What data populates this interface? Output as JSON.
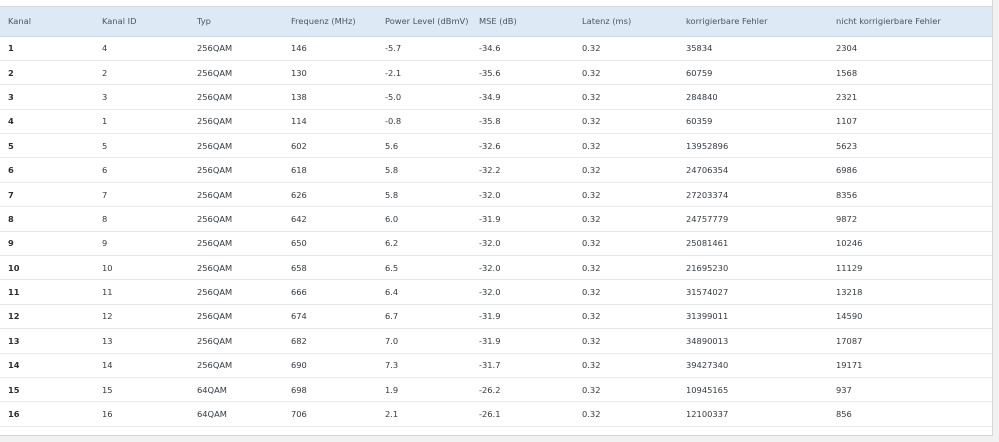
{
  "table": {
    "headers": [
      "Kanal",
      "Kanal ID",
      "Typ",
      "Frequenz (MHz)",
      "Power Level (dBmV)",
      "MSE (dB)",
      "Latenz (ms)",
      "korrigierbare Fehler",
      "nicht korrigierbare Fehler"
    ],
    "rows": [
      [
        "1",
        "4",
        "256QAM",
        "146",
        "-5.7",
        "-34.6",
        "0.32",
        "35834",
        "2304"
      ],
      [
        "2",
        "2",
        "256QAM",
        "130",
        "-2.1",
        "-35.6",
        "0.32",
        "60759",
        "1568"
      ],
      [
        "3",
        "3",
        "256QAM",
        "138",
        "-5.0",
        "-34.9",
        "0.32",
        "284840",
        "2321"
      ],
      [
        "4",
        "1",
        "256QAM",
        "114",
        "-0.8",
        "-35.8",
        "0.32",
        "60359",
        "1107"
      ],
      [
        "5",
        "5",
        "256QAM",
        "602",
        "5.6",
        "-32.6",
        "0.32",
        "13952896",
        "5623"
      ],
      [
        "6",
        "6",
        "256QAM",
        "618",
        "5.8",
        "-32.2",
        "0.32",
        "24706354",
        "6986"
      ],
      [
        "7",
        "7",
        "256QAM",
        "626",
        "5.8",
        "-32.0",
        "0.32",
        "27203374",
        "8356"
      ],
      [
        "8",
        "8",
        "256QAM",
        "642",
        "6.0",
        "-31.9",
        "0.32",
        "24757779",
        "9872"
      ],
      [
        "9",
        "9",
        "256QAM",
        "650",
        "6.2",
        "-32.0",
        "0.32",
        "25081461",
        "10246"
      ],
      [
        "10",
        "10",
        "256QAM",
        "658",
        "6.5",
        "-32.0",
        "0.32",
        "21695230",
        "11129"
      ],
      [
        "11",
        "11",
        "256QAM",
        "666",
        "6.4",
        "-32.0",
        "0.32",
        "31574027",
        "13218"
      ],
      [
        "12",
        "12",
        "256QAM",
        "674",
        "6.7",
        "-31.9",
        "0.32",
        "31399011",
        "14590"
      ],
      [
        "13",
        "13",
        "256QAM",
        "682",
        "7.0",
        "-31.9",
        "0.32",
        "34890013",
        "17087"
      ],
      [
        "14",
        "14",
        "256QAM",
        "690",
        "7.3",
        "-31.7",
        "0.32",
        "39427340",
        "19171"
      ],
      [
        "15",
        "15",
        "64QAM",
        "698",
        "1.9",
        "-26.2",
        "0.32",
        "10945165",
        "937"
      ],
      [
        "16",
        "16",
        "64QAM",
        "706",
        "2.1",
        "-26.1",
        "0.32",
        "12100337",
        "856"
      ]
    ]
  },
  "colors": {
    "header_bg": "#dde9f4",
    "page_bg": "#f1f1f1"
  }
}
